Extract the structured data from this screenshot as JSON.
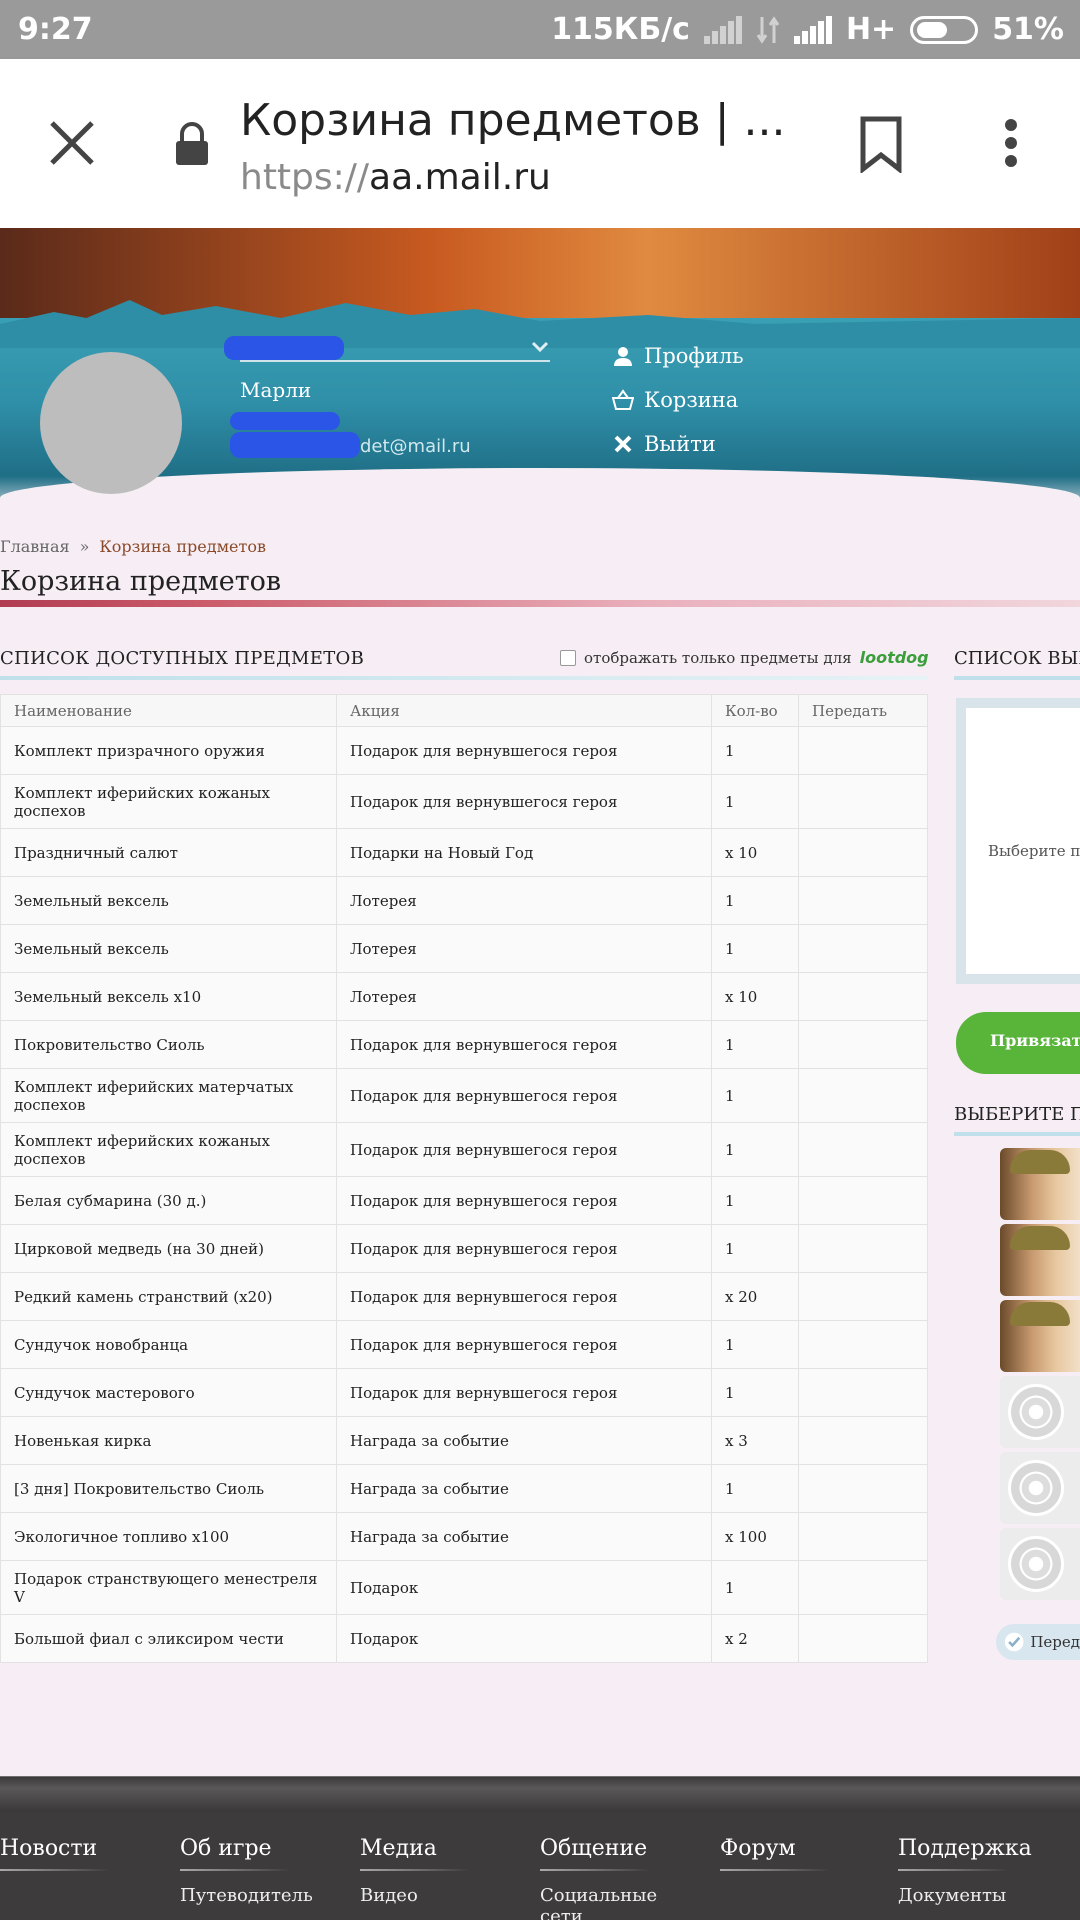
{
  "status": {
    "time": "9:27",
    "speed": "115КБ/с",
    "network": "H+",
    "battery": "51%"
  },
  "browser": {
    "title": "Корзина предметов | ...",
    "url_proto": "https://",
    "url_host": "aa.mail.ru"
  },
  "user": {
    "nick": "Марли",
    "email_suffix": "det@mail.ru"
  },
  "header_menu": {
    "profile": "Профиль",
    "cart": "Корзина",
    "logout": "Выйти"
  },
  "breadcrumb": {
    "home": "Главная",
    "sep": "»",
    "current": "Корзина предметов"
  },
  "page_title": "Корзина предметов",
  "left_panel": {
    "title": "СПИСОК ДОСТУПНЫХ ПРЕДМЕТОВ",
    "filter_label": "отображать только предметы для",
    "lootdog": "lootdog",
    "columns": [
      "Наименование",
      "Акция",
      "Кол-во",
      "Передать"
    ],
    "rows": [
      {
        "name": "Комплект призрачного оружия",
        "action": "Подарок для вернувшегося героя",
        "qty": "1"
      },
      {
        "name": "Комплект иферийских кожаных доспехов",
        "action": "Подарок для вернувшегося героя",
        "qty": "1"
      },
      {
        "name": "Праздничный салют",
        "action": "Подарки на Новый Год",
        "qty": "x 10"
      },
      {
        "name": "Земельный вексель",
        "action": "Лотерея",
        "qty": "1"
      },
      {
        "name": "Земельный вексель",
        "action": "Лотерея",
        "qty": "1"
      },
      {
        "name": "Земельный вексель x10",
        "action": "Лотерея",
        "qty": "x 10"
      },
      {
        "name": "Покровительство Сиоль",
        "action": "Подарок для вернувшегося героя",
        "qty": "1"
      },
      {
        "name": "Комплект иферийских матерчатых доспехов",
        "action": "Подарок для вернувшегося героя",
        "qty": "1"
      },
      {
        "name": "Комплект иферийских кожаных доспехов",
        "action": "Подарок для вернувшегося героя",
        "qty": "1"
      },
      {
        "name": "Белая субмарина (30 д.)",
        "action": "Подарок для вернувшегося героя",
        "qty": "1"
      },
      {
        "name": "Цирковой медведь (на 30 дней)",
        "action": "Подарок для вернувшегося героя",
        "qty": "1"
      },
      {
        "name": "Редкий камень странствий (x20)",
        "action": "Подарок для вернувшегося героя",
        "qty": "x 20"
      },
      {
        "name": "Сундучок новобранца",
        "action": "Подарок для вернувшегося героя",
        "qty": "1"
      },
      {
        "name": "Сундучок мастерового",
        "action": "Подарок для вернувшегося героя",
        "qty": "1"
      },
      {
        "name": "Новенькая кирка",
        "action": "Награда за событие",
        "qty": "x 3"
      },
      {
        "name": "[3 дня] Покровительство Сиоль",
        "action": "Награда за событие",
        "qty": "1"
      },
      {
        "name": "Экологичное топливо x100",
        "action": "Награда за событие",
        "qty": "x 100"
      },
      {
        "name": "Подарок странствующего менестреля V",
        "action": "Подарок",
        "qty": "1"
      },
      {
        "name": "Большой фиал с эликсиром чести",
        "action": "Подарок",
        "qty": "x 2"
      }
    ]
  },
  "right_panel": {
    "title": "СПИСОК ВЫБР",
    "placeholder": "Выберите п",
    "bind_button": "Привязать",
    "title2": "ВЫБЕРИТЕ ПЕ",
    "transfer": "Перед"
  },
  "footer": [
    {
      "head": "Новости",
      "sub": ""
    },
    {
      "head": "Об игре",
      "sub": "Путеводитель"
    },
    {
      "head": "Медиа",
      "sub": "Видео"
    },
    {
      "head": "Общение",
      "sub": "Социальные сети"
    },
    {
      "head": "Форум",
      "sub": ""
    },
    {
      "head": "Поддержка",
      "sub": "Документы"
    }
  ]
}
